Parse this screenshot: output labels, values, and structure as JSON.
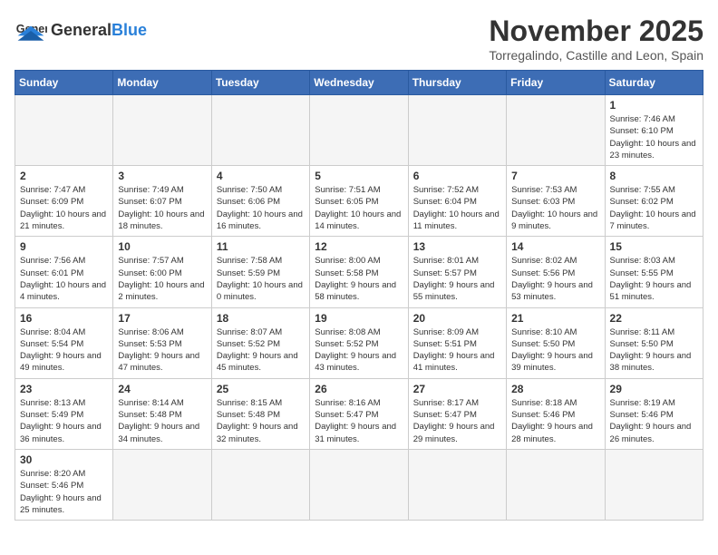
{
  "header": {
    "logo_general": "General",
    "logo_blue": "Blue",
    "title": "November 2025",
    "subtitle": "Torregalindo, Castille and Leon, Spain"
  },
  "weekdays": [
    "Sunday",
    "Monday",
    "Tuesday",
    "Wednesday",
    "Thursday",
    "Friday",
    "Saturday"
  ],
  "days": [
    {
      "num": "",
      "info": ""
    },
    {
      "num": "",
      "info": ""
    },
    {
      "num": "",
      "info": ""
    },
    {
      "num": "",
      "info": ""
    },
    {
      "num": "",
      "info": ""
    },
    {
      "num": "",
      "info": ""
    },
    {
      "num": "1",
      "info": "Sunrise: 7:46 AM\nSunset: 6:10 PM\nDaylight: 10 hours and 23 minutes."
    },
    {
      "num": "2",
      "info": "Sunrise: 7:47 AM\nSunset: 6:09 PM\nDaylight: 10 hours and 21 minutes."
    },
    {
      "num": "3",
      "info": "Sunrise: 7:49 AM\nSunset: 6:07 PM\nDaylight: 10 hours and 18 minutes."
    },
    {
      "num": "4",
      "info": "Sunrise: 7:50 AM\nSunset: 6:06 PM\nDaylight: 10 hours and 16 minutes."
    },
    {
      "num": "5",
      "info": "Sunrise: 7:51 AM\nSunset: 6:05 PM\nDaylight: 10 hours and 14 minutes."
    },
    {
      "num": "6",
      "info": "Sunrise: 7:52 AM\nSunset: 6:04 PM\nDaylight: 10 hours and 11 minutes."
    },
    {
      "num": "7",
      "info": "Sunrise: 7:53 AM\nSunset: 6:03 PM\nDaylight: 10 hours and 9 minutes."
    },
    {
      "num": "8",
      "info": "Sunrise: 7:55 AM\nSunset: 6:02 PM\nDaylight: 10 hours and 7 minutes."
    },
    {
      "num": "9",
      "info": "Sunrise: 7:56 AM\nSunset: 6:01 PM\nDaylight: 10 hours and 4 minutes."
    },
    {
      "num": "10",
      "info": "Sunrise: 7:57 AM\nSunset: 6:00 PM\nDaylight: 10 hours and 2 minutes."
    },
    {
      "num": "11",
      "info": "Sunrise: 7:58 AM\nSunset: 5:59 PM\nDaylight: 10 hours and 0 minutes."
    },
    {
      "num": "12",
      "info": "Sunrise: 8:00 AM\nSunset: 5:58 PM\nDaylight: 9 hours and 58 minutes."
    },
    {
      "num": "13",
      "info": "Sunrise: 8:01 AM\nSunset: 5:57 PM\nDaylight: 9 hours and 55 minutes."
    },
    {
      "num": "14",
      "info": "Sunrise: 8:02 AM\nSunset: 5:56 PM\nDaylight: 9 hours and 53 minutes."
    },
    {
      "num": "15",
      "info": "Sunrise: 8:03 AM\nSunset: 5:55 PM\nDaylight: 9 hours and 51 minutes."
    },
    {
      "num": "16",
      "info": "Sunrise: 8:04 AM\nSunset: 5:54 PM\nDaylight: 9 hours and 49 minutes."
    },
    {
      "num": "17",
      "info": "Sunrise: 8:06 AM\nSunset: 5:53 PM\nDaylight: 9 hours and 47 minutes."
    },
    {
      "num": "18",
      "info": "Sunrise: 8:07 AM\nSunset: 5:52 PM\nDaylight: 9 hours and 45 minutes."
    },
    {
      "num": "19",
      "info": "Sunrise: 8:08 AM\nSunset: 5:52 PM\nDaylight: 9 hours and 43 minutes."
    },
    {
      "num": "20",
      "info": "Sunrise: 8:09 AM\nSunset: 5:51 PM\nDaylight: 9 hours and 41 minutes."
    },
    {
      "num": "21",
      "info": "Sunrise: 8:10 AM\nSunset: 5:50 PM\nDaylight: 9 hours and 39 minutes."
    },
    {
      "num": "22",
      "info": "Sunrise: 8:11 AM\nSunset: 5:50 PM\nDaylight: 9 hours and 38 minutes."
    },
    {
      "num": "23",
      "info": "Sunrise: 8:13 AM\nSunset: 5:49 PM\nDaylight: 9 hours and 36 minutes."
    },
    {
      "num": "24",
      "info": "Sunrise: 8:14 AM\nSunset: 5:48 PM\nDaylight: 9 hours and 34 minutes."
    },
    {
      "num": "25",
      "info": "Sunrise: 8:15 AM\nSunset: 5:48 PM\nDaylight: 9 hours and 32 minutes."
    },
    {
      "num": "26",
      "info": "Sunrise: 8:16 AM\nSunset: 5:47 PM\nDaylight: 9 hours and 31 minutes."
    },
    {
      "num": "27",
      "info": "Sunrise: 8:17 AM\nSunset: 5:47 PM\nDaylight: 9 hours and 29 minutes."
    },
    {
      "num": "28",
      "info": "Sunrise: 8:18 AM\nSunset: 5:46 PM\nDaylight: 9 hours and 28 minutes."
    },
    {
      "num": "29",
      "info": "Sunrise: 8:19 AM\nSunset: 5:46 PM\nDaylight: 9 hours and 26 minutes."
    },
    {
      "num": "30",
      "info": "Sunrise: 8:20 AM\nSunset: 5:46 PM\nDaylight: 9 hours and 25 minutes."
    },
    {
      "num": "",
      "info": ""
    },
    {
      "num": "",
      "info": ""
    },
    {
      "num": "",
      "info": ""
    },
    {
      "num": "",
      "info": ""
    },
    {
      "num": "",
      "info": ""
    },
    {
      "num": "",
      "info": ""
    }
  ]
}
